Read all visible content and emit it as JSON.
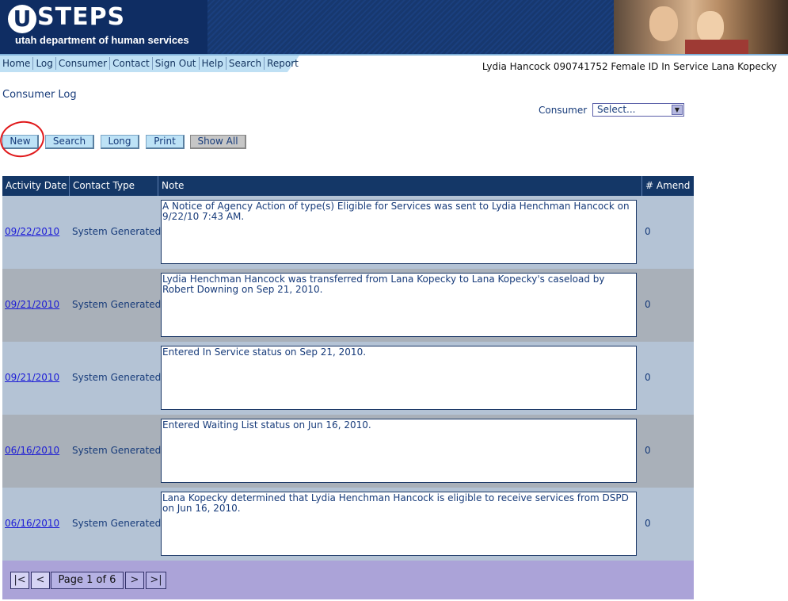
{
  "header": {
    "logo_letter": "U",
    "logo_text": "STEPS",
    "subtitle": "utah department of human services"
  },
  "nav": {
    "links": [
      "Home",
      "Log",
      "Consumer",
      "Contact",
      "Sign Out",
      "Help",
      "Search",
      "Report"
    ],
    "info": "Lydia Hancock 090741752 Female ID In Service Lana Kopecky"
  },
  "page": {
    "title": "Consumer Log",
    "consumer_label": "Consumer",
    "consumer_select": "Select...",
    "buttons": {
      "new": "New",
      "search": "Search",
      "long": "Long",
      "print": "Print",
      "show_all": "Show All"
    }
  },
  "table": {
    "headers": [
      "Activity Date",
      "Contact Type",
      "Note",
      "# Amend"
    ],
    "rows": [
      {
        "date": "09/22/2010",
        "type": "System Generated",
        "note": "A Notice of Agency Action of type(s) Eligible for Services was sent to Lydia Henchman Hancock on 9/22/10 7:43 AM.",
        "amend": "0"
      },
      {
        "date": "09/21/2010",
        "type": "System Generated",
        "note": "Lydia Henchman Hancock was transferred from Lana Kopecky to Lana Kopecky's caseload by Robert Downing on Sep 21, 2010.",
        "amend": "0"
      },
      {
        "date": "09/21/2010",
        "type": "System Generated",
        "note": "Entered In Service status on Sep 21, 2010.",
        "amend": "0"
      },
      {
        "date": "06/16/2010",
        "type": "System Generated",
        "note": "Entered Waiting List status on Jun 16, 2010.",
        "amend": "0"
      },
      {
        "date": "06/16/2010",
        "type": "System Generated",
        "note": "Lana Kopecky determined that Lydia Henchman Hancock is eligible to receive services from DSPD on Jun 16, 2010.",
        "amend": "0"
      }
    ]
  },
  "pager": {
    "first": "|<",
    "prev": "<",
    "label": "Page 1 of 6",
    "next": ">",
    "last": ">|"
  }
}
